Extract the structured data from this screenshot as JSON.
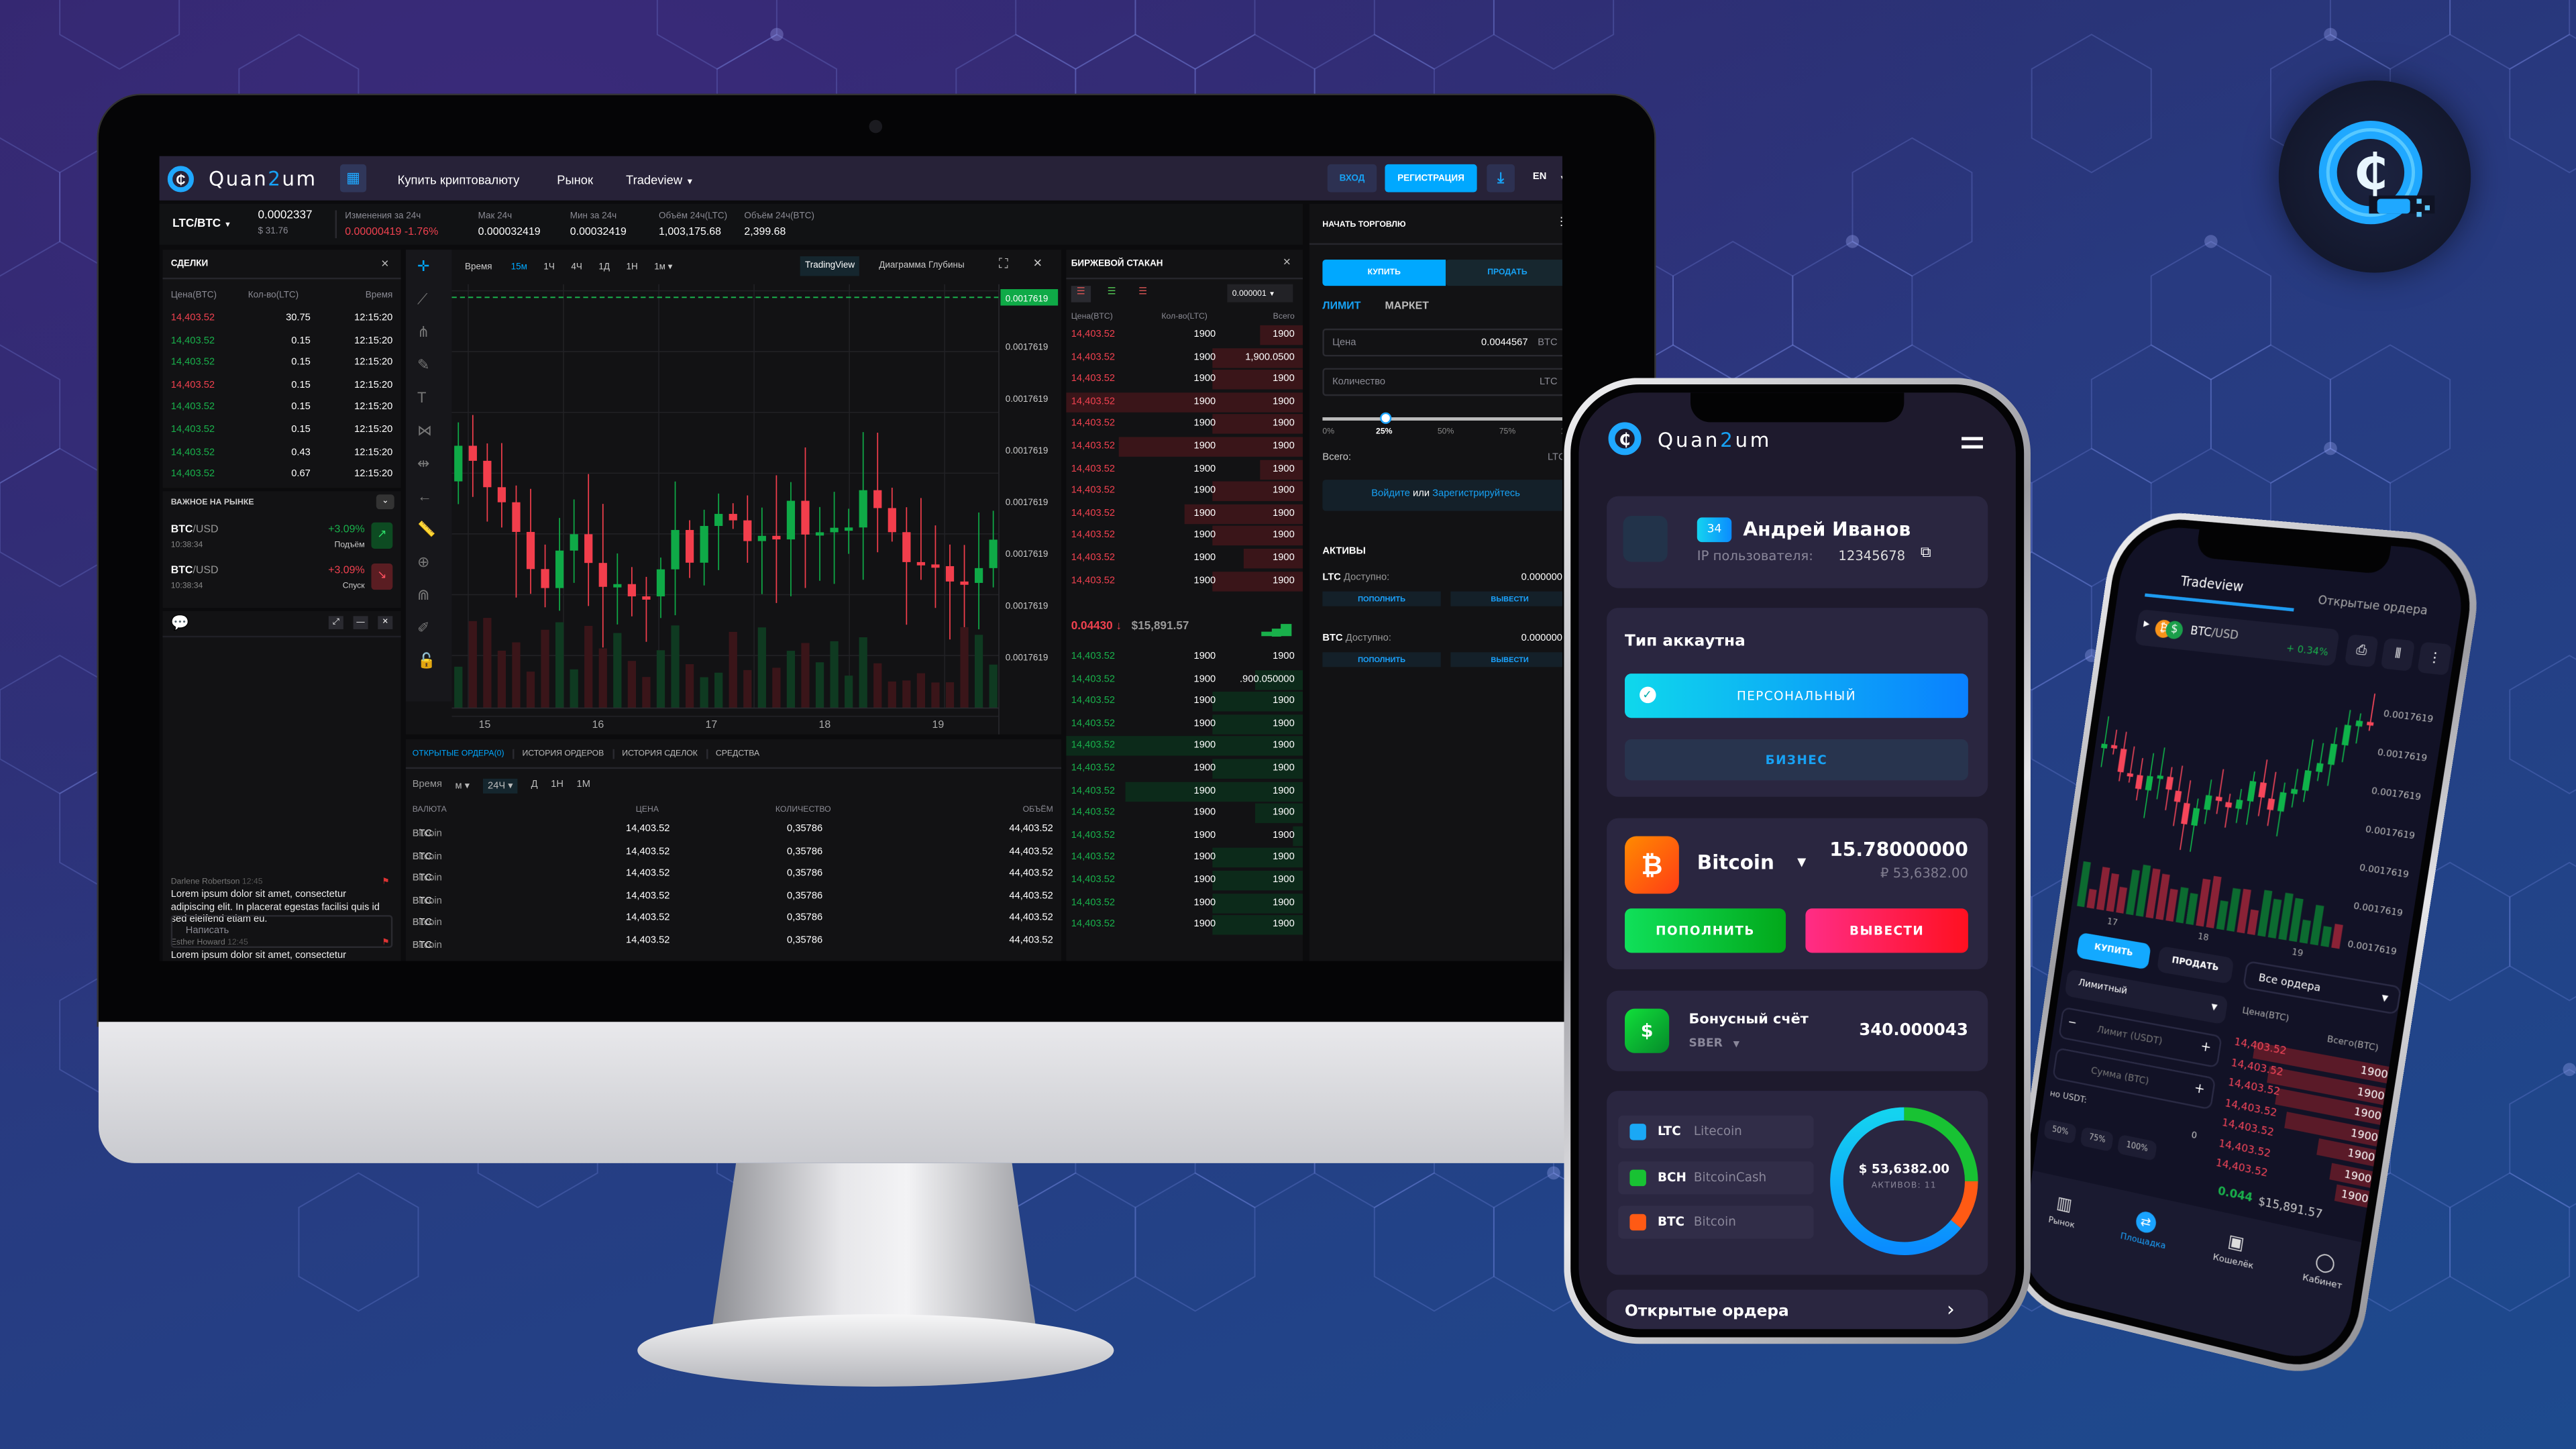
{
  "brand": {
    "part1": "Quan",
    "part2": "2",
    "part3": "um"
  },
  "nav": {
    "links": [
      "Купить криптовалюту",
      "Рынок",
      "Tradeview"
    ],
    "login": "ВХОД",
    "register": "РЕГИСТРАЦИЯ",
    "lang": "EN"
  },
  "ticker": {
    "pair": "LTC/BTC",
    "price": "0.0002337",
    "price_usd": "$ 31.76",
    "stats": [
      {
        "label": "Изменения за 24ч",
        "value": "0.00000419",
        "pct": "-1.76%"
      },
      {
        "label": "Мак 24ч",
        "value": "0.000032419"
      },
      {
        "label": "Мин за 24ч",
        "value": "0.00032419"
      },
      {
        "label": "Объём 24ч(LTC)",
        "value": "1,003,175.68"
      },
      {
        "label": "Объём 24ч(BTC)",
        "value": "2,399.68"
      }
    ]
  },
  "trades": {
    "title": "СДЕЛКИ",
    "columns": [
      "Цена(BTC)",
      "Кол-во(LTC)",
      "Время"
    ],
    "rows": [
      {
        "price": "14,403.52",
        "qty": "30.75",
        "time": "12:15:20",
        "side": "sell"
      },
      {
        "price": "14,403.52",
        "qty": "0.15",
        "time": "12:15:20",
        "side": "buy"
      },
      {
        "price": "14,403.52",
        "qty": "0.15",
        "time": "12:15:20",
        "side": "buy"
      },
      {
        "price": "14,403.52",
        "qty": "0.15",
        "time": "12:15:20",
        "side": "sell"
      },
      {
        "price": "14,403.52",
        "qty": "0.15",
        "time": "12:15:20",
        "side": "buy"
      },
      {
        "price": "14,403.52",
        "qty": "0.15",
        "time": "12:15:20",
        "side": "buy"
      },
      {
        "price": "14,403.52",
        "qty": "0.43",
        "time": "12:15:20",
        "side": "buy"
      },
      {
        "price": "14,403.52",
        "qty": "0.67",
        "time": "12:15:20",
        "side": "buy"
      }
    ]
  },
  "market": {
    "title": "ВАЖНОЕ НА РЫНКЕ",
    "items": [
      {
        "base": "BTC",
        "quote": "/USD",
        "time": "10:38:34",
        "change": "+3.09%",
        "label": "Подъём",
        "trend": "up"
      },
      {
        "base": "BTC",
        "quote": "/USD",
        "time": "10:38:34",
        "change": "+3.09%",
        "label": "Спуск",
        "trend": "down"
      }
    ]
  },
  "chat": {
    "placeholder": "Написать",
    "messages": [
      {
        "author": "Darlene Robertson",
        "time": "12:45",
        "text": "Lorem ipsum dolor sit amet, consectetur adipiscing elit. In placerat egestas facilisi quis id sed eleifend etiam eu."
      },
      {
        "author": "Esther Howard",
        "time": "12:45",
        "text": "Lorem ipsum dolor sit amet, consectetur adipiscing elit. In placerat egestas facilisi quis id sed eleifend etiam eu."
      }
    ]
  },
  "chart": {
    "time_label": "Время",
    "intervals": [
      "15м",
      "1Ч",
      "4Ч",
      "1Д",
      "1Н",
      "1м"
    ],
    "active_interval": "15м",
    "views": [
      "TradingView",
      "Диаграмма Глубины"
    ],
    "current_price": "0.0017619",
    "price_labels": [
      "0.0017619",
      "0.0017619",
      "0.0017619",
      "0.0017619",
      "0.0017619",
      "0.0017619",
      "0.0017619"
    ],
    "x_labels": [
      "15",
      "16",
      "17",
      "18",
      "19"
    ]
  },
  "orders": {
    "tabs": [
      "ОТКРЫТЫЕ ОРДЕРА(0)",
      "ИСТОРИЯ ОРДЕРОВ",
      "ИСТОРИЯ СДЕЛОК",
      "СРЕДСТВА"
    ],
    "filter": {
      "label": "Время",
      "options": [
        "м",
        "24Ч",
        "Д",
        "1Н",
        "1М"
      ],
      "active": "24Ч"
    },
    "columns": [
      "ВАЛЮТА",
      "ЦЕНА",
      "КОЛИЧЕСТВО",
      "ОБЪЁМ"
    ],
    "rows": [
      {
        "code": "BTC",
        "name": "Bitcoin",
        "price": "14,403.52",
        "qty": "0,35786",
        "volume": "44,403.52"
      },
      {
        "code": "BTC",
        "name": "Bitcoin",
        "price": "14,403.52",
        "qty": "0,35786",
        "volume": "44,403.52"
      },
      {
        "code": "BTC",
        "name": "Bitcoin",
        "price": "14,403.52",
        "qty": "0,35786",
        "volume": "44,403.52"
      },
      {
        "code": "BTC",
        "name": "Bitcoin",
        "price": "14,403.52",
        "qty": "0,35786",
        "volume": "44,403.52"
      },
      {
        "code": "BTC",
        "name": "Bitcoin",
        "price": "14,403.52",
        "qty": "0,35786",
        "volume": "44,403.52"
      },
      {
        "code": "BTC",
        "name": "Bitcoin",
        "price": "14,403.52",
        "qty": "0,35786",
        "volume": "44,403.52"
      }
    ]
  },
  "orderbook": {
    "title": "БИРЖЕВОЙ СТАКАН",
    "precision": "0.000001",
    "columns": [
      "Цена(BTC)",
      "Кол-во(LTC)",
      "Всего"
    ],
    "asks": [
      {
        "price": "14,403.52",
        "qty": "1900",
        "total": "1900",
        "depth": 0.18
      },
      {
        "price": "14,403.52",
        "qty": "1900",
        "total": "1,900.0500",
        "depth": 0.38
      },
      {
        "price": "14,403.52",
        "qty": "1900",
        "total": "1900",
        "depth": 0.38
      },
      {
        "price": "14,403.52",
        "qty": "1900",
        "total": "1900",
        "depth": 1.0
      },
      {
        "price": "14,403.52",
        "qty": "1900",
        "total": "1900",
        "depth": 0.38
      },
      {
        "price": "14,403.52",
        "qty": "1900",
        "total": "1900",
        "depth": 0.78
      },
      {
        "price": "14,403.52",
        "qty": "1900",
        "total": "1900",
        "depth": 0.18
      },
      {
        "price": "14,403.52",
        "qty": "1900",
        "total": "1900",
        "depth": 0.38
      },
      {
        "price": "14,403.52",
        "qty": "1900",
        "total": "1900",
        "depth": 0.5
      },
      {
        "price": "14,403.52",
        "qty": "1900",
        "total": "1900",
        "depth": 0.38
      },
      {
        "price": "14,403.52",
        "qty": "1900",
        "total": "1900",
        "depth": 0.25
      },
      {
        "price": "14,403.52",
        "qty": "1900",
        "total": "1900",
        "depth": 0.38
      }
    ],
    "mid": {
      "price": "0.04430",
      "usd": "$15,891.57"
    },
    "bids": [
      {
        "price": "14,403.52",
        "qty": "1900",
        "total": "1900",
        "depth": 0.0
      },
      {
        "price": "14,403.52",
        "qty": "1900",
        "total": ".900.050000",
        "depth": 0.2
      },
      {
        "price": "14,403.52",
        "qty": "1900",
        "total": "1900",
        "depth": 0.38
      },
      {
        "price": "14,403.52",
        "qty": "1900",
        "total": "1900",
        "depth": 0.38
      },
      {
        "price": "14,403.52",
        "qty": "1900",
        "total": "1900",
        "depth": 1.0
      },
      {
        "price": "14,403.52",
        "qty": "1900",
        "total": "1900",
        "depth": 0.38
      },
      {
        "price": "14,403.52",
        "qty": "1900",
        "total": "1900",
        "depth": 0.75
      },
      {
        "price": "14,403.52",
        "qty": "1900",
        "total": "1900",
        "depth": 0.2
      },
      {
        "price": "14,403.52",
        "qty": "1900",
        "total": "1900",
        "depth": 0.04
      },
      {
        "price": "14,403.52",
        "qty": "1900",
        "total": "1900",
        "depth": 0.38
      },
      {
        "price": "14,403.52",
        "qty": "1900",
        "total": "1900",
        "depth": 0.38
      },
      {
        "price": "14,403.52",
        "qty": "1900",
        "total": "1900",
        "depth": 0.38
      },
      {
        "price": "14,403.52",
        "qty": "1900",
        "total": "1900",
        "depth": 0.38
      }
    ]
  },
  "trade_form": {
    "title": "НАЧАТЬ ТОРГОВЛЮ",
    "buy": "КУПИТЬ",
    "sell": "ПРОДАТЬ",
    "limit": "ЛИМИТ",
    "market": "МАРКЕТ",
    "price_label": "Цена",
    "price_value": "0.0044567",
    "price_unit": "BTC",
    "qty_label": "Количество",
    "qty_unit": "LTC",
    "slider_percent": 25,
    "slider_marks": [
      "0%",
      "25%",
      "50%",
      "75%",
      "100%"
    ],
    "total_label": "Всего:",
    "total_unit": "LTC",
    "login_link": "Войдите",
    "or": "или",
    "register_link": "Зарегистрируйтесь",
    "assets_title": "АКТИВЫ",
    "assets": [
      {
        "code": "LTC",
        "label": "Доступно:",
        "value": "0.000000",
        "deposit": "ПОПОЛНИТЬ",
        "withdraw": "ВЫВЕСТИ"
      },
      {
        "code": "BTC",
        "label": "Доступно:",
        "value": "0.000000",
        "deposit": "ПОПОЛНИТЬ",
        "withdraw": "ВЫВЕСТИ"
      }
    ]
  },
  "phone_account": {
    "level": "34",
    "name": "Андрей Иванов",
    "ip_label": "IP пользователя:",
    "ip_value": "12345678",
    "account_type_title": "Тип аккаутна",
    "personal": "ПЕРСОНАЛЬНЫЙ",
    "business": "БИЗНЕС",
    "coin": {
      "name": "Bitcoin",
      "amount": "15.78000000",
      "fiat": "₽ 53,6382.00",
      "deposit": "ПОПОЛНИТЬ",
      "withdraw": "ВЫВЕСТИ"
    },
    "bonus": {
      "title": "Бонусный счёт",
      "bank": "SBER",
      "amount": "340.000043"
    },
    "portfolio": {
      "total": "$ 53,6382.00",
      "count_label": "АКТИВОВ: 11",
      "assets": [
        {
          "code": "LTC",
          "name": "Litecoin",
          "color": "#1aa8f5",
          "share": 0.64
        },
        {
          "code": "BCH",
          "name": "BitcoinCash",
          "color": "#18c233",
          "share": 0.25
        },
        {
          "code": "BTC",
          "name": "Bitcoin",
          "color": "#ff5a14",
          "share": 0.11
        }
      ]
    },
    "open_orders": "Открытые ордера"
  },
  "phone_trade": {
    "tabs": [
      "Tradeview",
      "Открытые ордера"
    ],
    "pair_base": "BTC",
    "pair_quote": "/USD",
    "change": "+ 0.34%",
    "price_labels": [
      "0.0017619",
      "0.0017619",
      "0.0017619",
      "0.0017619",
      "0.0017619",
      "0.0017619",
      "0.0017619"
    ],
    "x_labels": [
      "17",
      "18",
      "19"
    ],
    "buy": "КУПИТЬ",
    "sell": "ПРОДАТЬ",
    "orders_select": "Все ордера",
    "type_select": "Лимитный",
    "price_col": "Цена(BTC)",
    "total_col": "Всего(BTC)",
    "limit_input": "Лимит (USDT)",
    "amount_input": "Сумма (BTC)",
    "available": "но USDT:",
    "available_value": "0",
    "pcts": [
      "50%",
      "75%",
      "100%"
    ],
    "asks": [
      {
        "price": "14,403.52",
        "total": "1900",
        "depth": 0.85
      },
      {
        "price": "14,403.52",
        "total": "1900",
        "depth": 0.75
      },
      {
        "price": "14,403.52",
        "total": "1900",
        "depth": 0.68
      },
      {
        "price": "14,403.52",
        "total": "1900",
        "depth": 0.6
      },
      {
        "price": "14,403.52",
        "total": "1900",
        "depth": 0.38
      },
      {
        "price": "14,403.52",
        "total": "1900",
        "depth": 0.28
      },
      {
        "price": "14,403.52",
        "total": "1900",
        "depth": 0.24
      }
    ],
    "mid_price": "0.044",
    "mid_usd": "$15,891.57",
    "bottom_nav": [
      {
        "label": "Рынок",
        "active": false
      },
      {
        "label": "Площадка",
        "active": true
      },
      {
        "label": "Кошелёк",
        "active": false
      },
      {
        "label": "Кабинет",
        "active": false
      }
    ]
  },
  "colors": {
    "accent": "#00a8ff",
    "up": "#19b04b",
    "down": "#f0414f",
    "nav_bg": "#272238",
    "phone_bg": "#1e1a2d"
  }
}
